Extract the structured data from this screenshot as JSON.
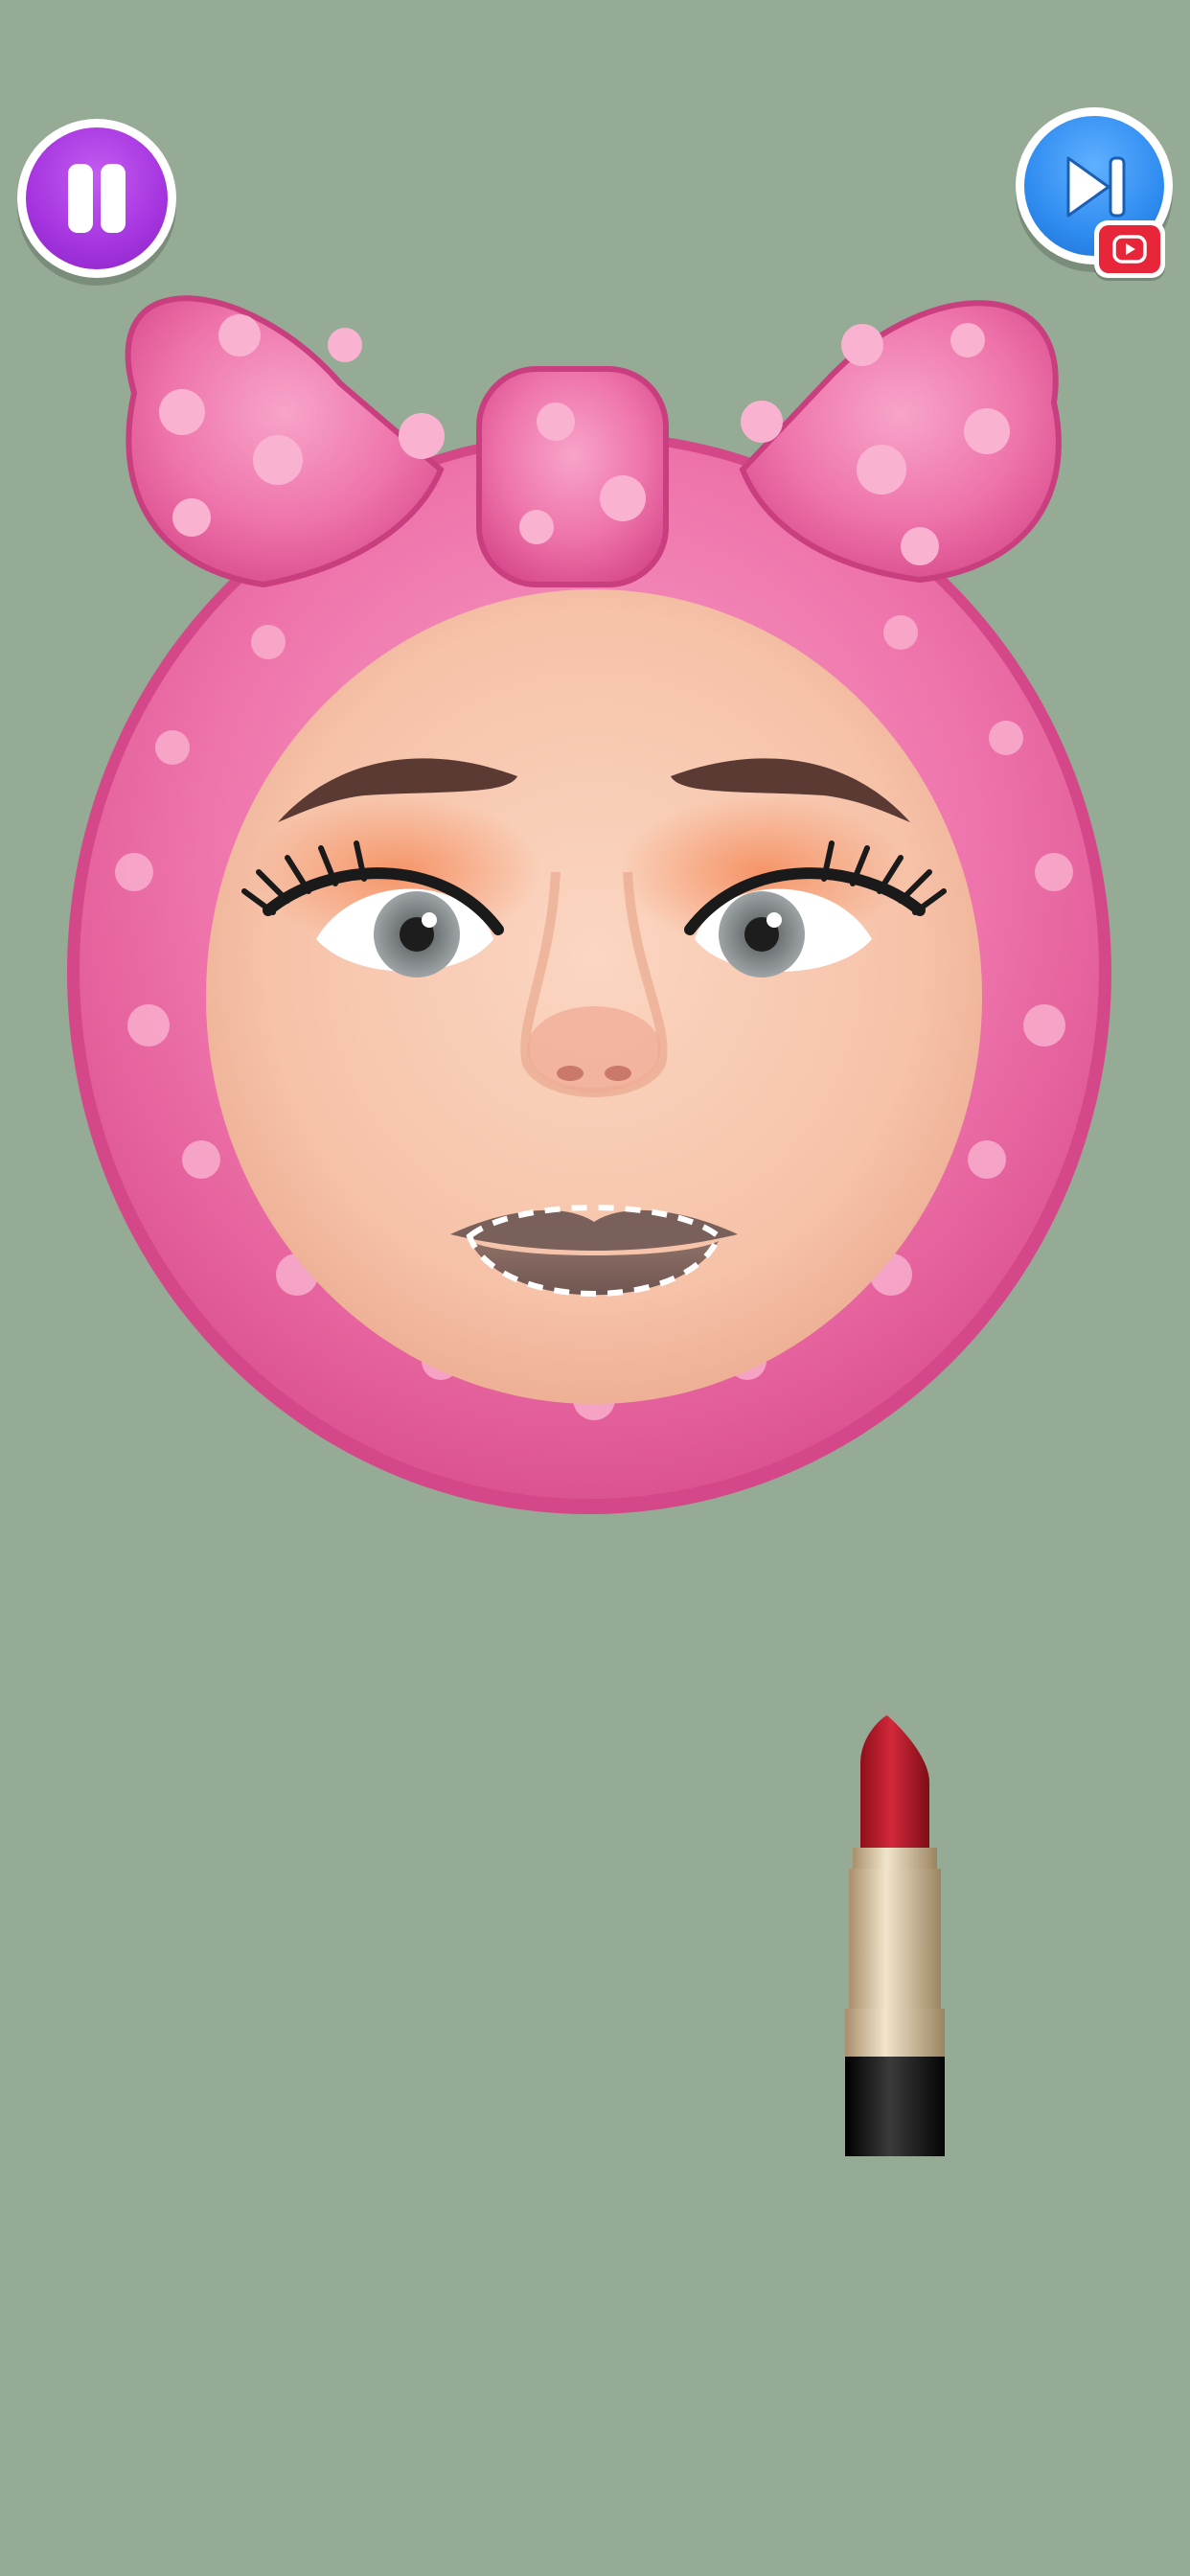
{
  "hud": {
    "pause_icon": "pause-icon",
    "skip_icon": "skip-forward-icon",
    "ad_icon": "video-play-icon"
  },
  "colors": {
    "background": "#95ab95",
    "pause_button": "#a534df",
    "skip_button": "#2f8cf0",
    "ad_badge": "#e8263a",
    "headband": "#ec6fa6",
    "lipstick": "#c81e2b"
  },
  "scene": {
    "character": "face-with-pink-bow-headband",
    "target_area": "lips-dashed-outline",
    "tool": "red-lipstick"
  }
}
